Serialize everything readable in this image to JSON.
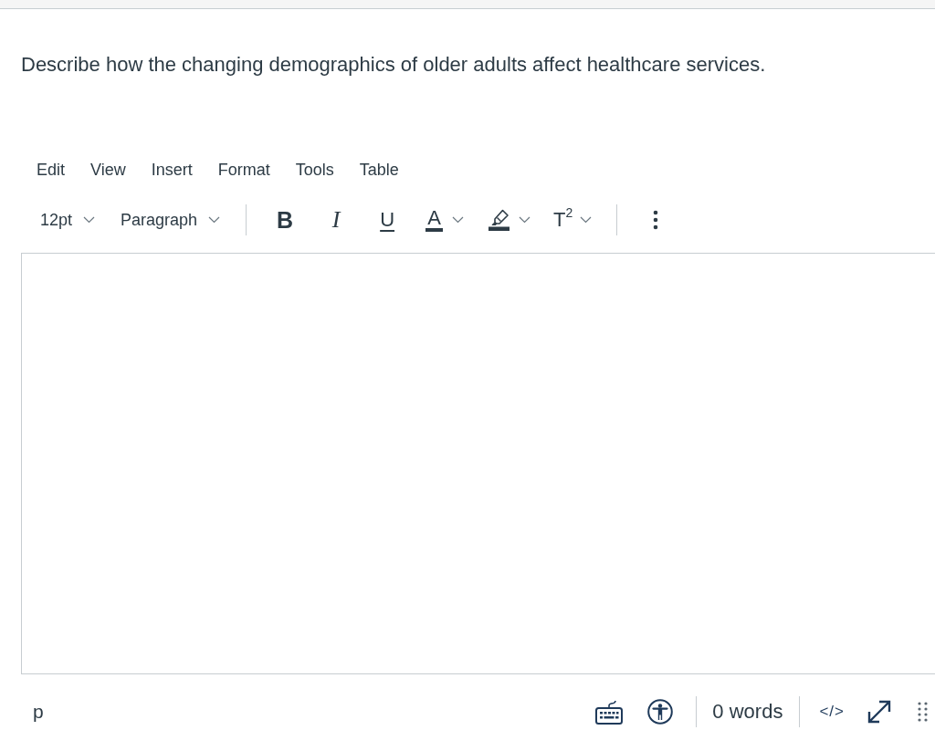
{
  "question": {
    "text": "Describe how the changing demographics of older adults affect healthcare services."
  },
  "editor": {
    "menu_bar": [
      {
        "label": "Edit"
      },
      {
        "label": "View"
      },
      {
        "label": "Insert"
      },
      {
        "label": "Format"
      },
      {
        "label": "Tools"
      },
      {
        "label": "Table"
      }
    ],
    "toolbar": [
      {
        "kind": "dropdown",
        "label": "12pt"
      },
      {
        "kind": "dropdown",
        "label": "Paragraph"
      },
      {
        "kind": "separator"
      },
      {
        "kind": "bold",
        "label": "B"
      },
      {
        "kind": "italic",
        "label": "I"
      },
      {
        "kind": "underline",
        "label": "U"
      },
      {
        "kind": "text_color",
        "label": "A"
      },
      {
        "kind": "highlight"
      },
      {
        "kind": "superscript",
        "label": "T$^{2}$"
      },
      {
        "kind": "separator"
      },
      {
        "kind": "more"
      }
    ],
    "status_bar": {
      "path": "p",
      "word_count": "0 words",
      "html_toggle": "</>"
    }
  }
}
